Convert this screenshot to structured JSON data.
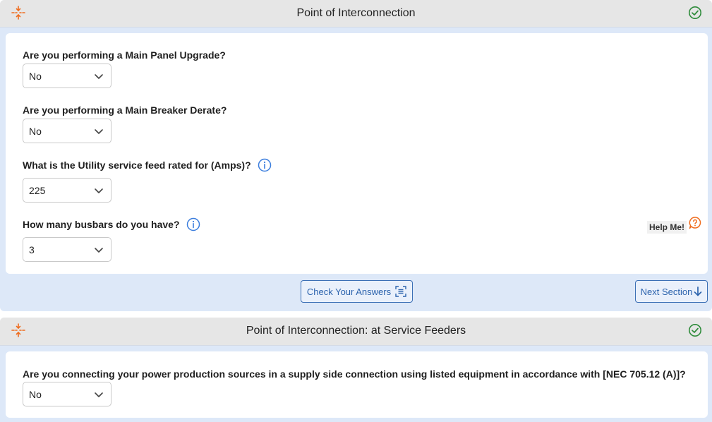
{
  "sections": [
    {
      "title": "Point of Interconnection",
      "questions": [
        {
          "label": "Are you performing a Main Panel Upgrade?",
          "value": "No"
        },
        {
          "label": "Are you performing a Main Breaker Derate?",
          "value": "No"
        },
        {
          "label": "What is the Utility service feed rated for (Amps)?",
          "value": "225"
        },
        {
          "label": "How many busbars do you have?",
          "value": "3"
        }
      ],
      "help_label": "Help Me!",
      "check_answers_label": "Check Your Answers",
      "next_section_label": "Next Section"
    },
    {
      "title": "Point of Interconnection: at Service Feeders",
      "questions": [
        {
          "label": "Are you connecting your power production sources in a supply side connection using listed equipment in accordance with [NEC 705.12 (A)]?",
          "value": "No"
        }
      ]
    }
  ],
  "colors": {
    "accent_orange": "#ef6c1e",
    "success_green": "#2e8b3a",
    "link_blue": "#2c63ad",
    "info_blue": "#3b7ddd"
  },
  "icons": {
    "collapse": "collapse-arrows-icon",
    "complete": "check-circle-icon",
    "info": "info-icon",
    "help": "help-bubble-icon",
    "scan": "scan-icon",
    "arrow_down": "arrow-down-icon",
    "dropdown": "chevron-down-icon"
  }
}
